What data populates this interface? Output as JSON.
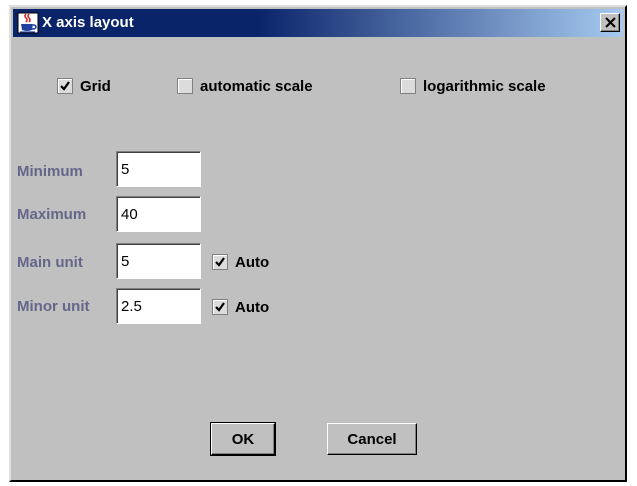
{
  "window": {
    "title": "X axis layout",
    "icons": {
      "app": "java-coffee-cup-icon",
      "close": "close-icon"
    }
  },
  "options": {
    "grid": {
      "label": "Grid",
      "checked": true
    },
    "automatic_scale": {
      "label": "automatic scale",
      "checked": false
    },
    "logarithmic_scale": {
      "label": "logarithmic scale",
      "checked": false
    }
  },
  "fields": {
    "minimum": {
      "label": "Minimum",
      "value": "5"
    },
    "maximum": {
      "label": "Maximum",
      "value": "40"
    },
    "main_unit": {
      "label": "Main unit",
      "value": "5",
      "auto_label": "Auto",
      "auto_checked": true
    },
    "minor_unit": {
      "label": "Minor unit",
      "value": "2.5",
      "auto_label": "Auto",
      "auto_checked": true
    }
  },
  "buttons": {
    "ok": "OK",
    "cancel": "Cancel"
  },
  "colors": {
    "title_bar": "#0a246a",
    "title_bar_end": "#a6caf0",
    "dialog_background": "#c0c0c0",
    "field_label": "#66668a"
  }
}
